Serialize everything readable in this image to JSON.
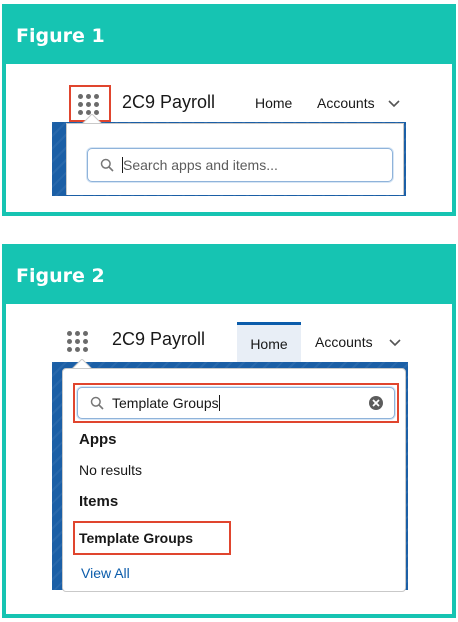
{
  "colors": {
    "accent": "#16c4b2",
    "highlight": "#e0452e",
    "link": "#0b5cab",
    "banner": "#1b5fa6"
  },
  "figure1": {
    "title": "Figure 1",
    "app_name": "2C9 Payroll",
    "nav": {
      "home": "Home",
      "accounts": "Accounts"
    },
    "search": {
      "placeholder": "Search apps and items..."
    },
    "icons": {
      "launcher": "app-launcher-grid-icon",
      "search": "search-icon",
      "more": "chevron-down-icon"
    }
  },
  "figure2": {
    "title": "Figure 2",
    "app_name": "2C9 Payroll",
    "nav": {
      "home": "Home",
      "accounts": "Accounts"
    },
    "search": {
      "value": "Template Groups"
    },
    "results": {
      "apps_heading": "Apps",
      "apps_empty": "No results",
      "items_heading": "Items",
      "items": [
        "Template Groups"
      ],
      "view_all": "View All"
    },
    "icons": {
      "launcher": "app-launcher-grid-icon",
      "search": "search-icon",
      "clear": "clear-icon",
      "more": "chevron-down-icon"
    }
  }
}
